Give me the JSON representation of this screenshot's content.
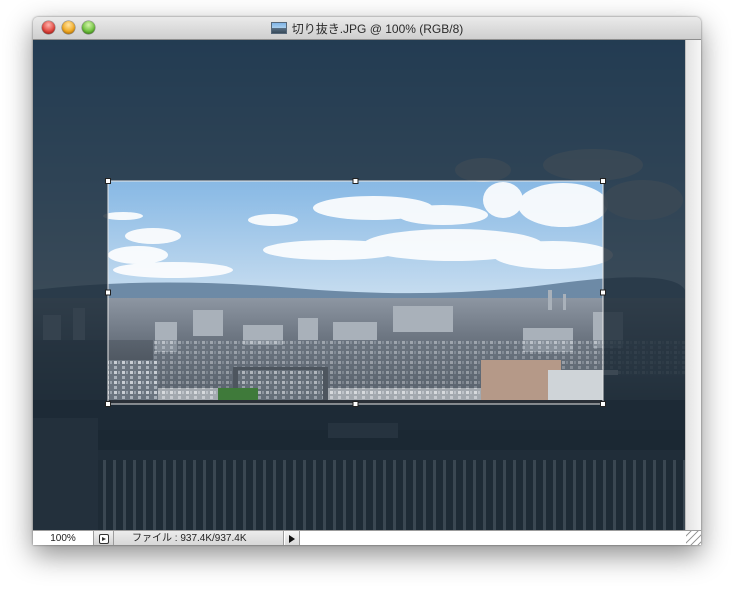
{
  "window": {
    "title": "切り抜き.JPG @ 100% (RGB/8)",
    "doc_icon": "image-thumbnail-icon"
  },
  "titlebar_buttons": {
    "close": "close-icon",
    "minimize": "minimize-icon",
    "zoom": "zoom-icon"
  },
  "statusbar": {
    "zoom_value": "100%",
    "info_text": "ファイル : 937.4K/937.4K",
    "menu_icon": "status-options-icon",
    "arrow_icon": "play-arrow-icon"
  },
  "crop": {
    "handle_count": 8,
    "shield_color": "#1b2a36"
  },
  "colors": {
    "sky_top": "#5a9ed8",
    "sky_bottom": "#b9d7ee",
    "shield": "#1b2a36"
  }
}
